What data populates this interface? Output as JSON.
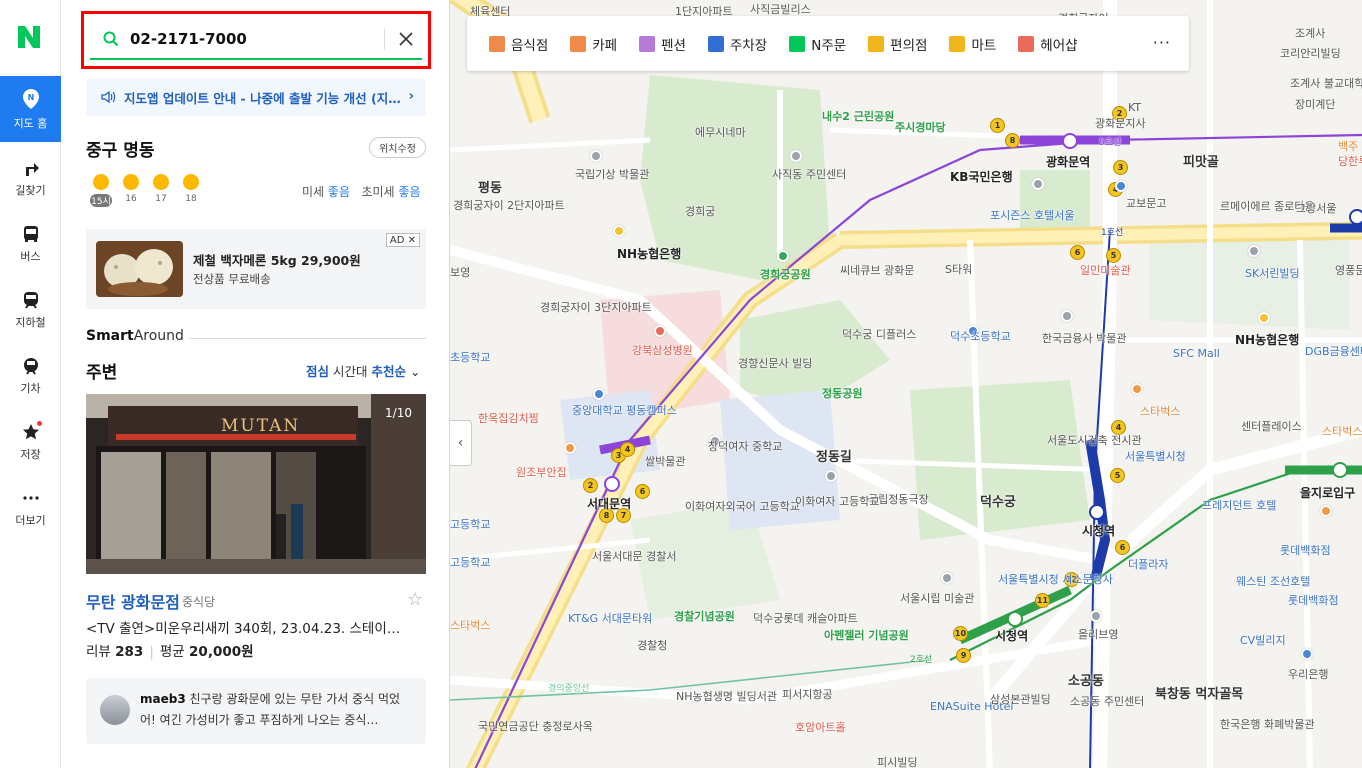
{
  "rail": {
    "logo": "N",
    "items": [
      {
        "label": "지도 홈",
        "icon": "map-pin-icon"
      },
      {
        "label": "길찾기",
        "icon": "directions-icon"
      },
      {
        "label": "버스",
        "icon": "bus-icon"
      },
      {
        "label": "지하철",
        "icon": "subway-icon"
      },
      {
        "label": "기차",
        "icon": "train-icon"
      },
      {
        "label": "저장",
        "icon": "star-icon"
      },
      {
        "label": "더보기",
        "icon": "more-icon"
      }
    ]
  },
  "search": {
    "value": "02-2171-7000"
  },
  "notice": {
    "text": "지도앱 업데이트 안내 - 나중에 출발 기능 개선 (지…"
  },
  "location": {
    "title": "중구 명동",
    "button": "위치수정"
  },
  "weather": {
    "hours": [
      "15시",
      "16",
      "17",
      "18"
    ],
    "dust_label": "미세",
    "dust_value": "좋음",
    "fine_dust_label": "초미세",
    "fine_dust_value": "좋음"
  },
  "ad": {
    "title": "제철 백자메론 5kg 29,900원",
    "subtitle": "전상품 무료배송",
    "tag": "AD"
  },
  "smart_around": {
    "brand_bold": "Smart",
    "brand_rest": "Around"
  },
  "nearby": {
    "title": "주변",
    "opt1": "점심",
    "opt2": "시간대",
    "opt3": "추천순"
  },
  "place": {
    "photo_count": "1/10",
    "sign": "MUTAN",
    "name": "무탄 광화문점",
    "category": "중식당",
    "desc": "<TV 출연>미운우리새끼 340회, 23.04.23. 스테이…",
    "review_label": "리뷰",
    "review_count": "283",
    "price_label": "평균",
    "price": "20,000원",
    "review_user": "maeb3",
    "review_text": "친구랑 광화문에 있는 무탄 가서 중식 먹었어! 여긴 가성비가 좋고 푸짐하게 나오는 중식…"
  },
  "categories": [
    {
      "label": "음식점",
      "color": "#f08a4b"
    },
    {
      "label": "카페",
      "color": "#f08a4b"
    },
    {
      "label": "펜션",
      "color": "#b57bd6"
    },
    {
      "label": "주차장",
      "color": "#2f6fd6"
    },
    {
      "label": "N주문",
      "color": "#03c75a"
    },
    {
      "label": "편의점",
      "color": "#f3b51c"
    },
    {
      "label": "마트",
      "color": "#f3b51c"
    },
    {
      "label": "헤어샵",
      "color": "#e86b5b"
    }
  ],
  "map_labels": {
    "l1": "체육센터",
    "l2": "1단지아파트",
    "l3": "사직금빌리스",
    "l4": "경희궁자이",
    "l5": "조계사",
    "l6": "에무시네마",
    "l7": "내수2 근린공원",
    "l8": "주시경마당",
    "l9": "KT",
    "l10": "광화문지사",
    "l11": "코리안리빌딩",
    "l12": "조계사 불교대학",
    "l13": "장미계단",
    "l14": "국립기상 박물관",
    "l15": "사직동 주민센터",
    "l16": "광화문역",
    "l17": "KB국민은행",
    "l18": "피맛골",
    "l19": "교보문고",
    "l20": "르메이에르 종로타운",
    "l21": "그랑서울",
    "l22": "경희궁자이 2단지아파트",
    "l23": "경희궁",
    "l24": "포시즌스 호텔서울",
    "l25": "NH농협은행",
    "l26": "경희궁공원",
    "l27": "씨네큐브 광화문",
    "l28": "S타워",
    "l29": "일민미술관",
    "l30": "SK서린빌딩",
    "l31": "영풍문고",
    "l32": "경희궁자이 3단지아파트",
    "l33": "덕수궁 디플러스",
    "l34": "덕수초등학교",
    "l35": "한국금융사 박물관",
    "l36": "NH농협은행",
    "l37": "강북삼성병원",
    "l38": "경향신문사 빌딩",
    "l39": "SFC Mall",
    "l40": "DGB금융센터",
    "l41": "정동공원",
    "l42": "중앙대학교 평동캠퍼스",
    "l43": "한옥집김치찜",
    "l44": "스타벅스",
    "l45": "센터플레이스",
    "l46": "창덕여자 중학교",
    "l47": "쌀박물관",
    "l48": "서울도시건축 전시관",
    "l49": "서울특별시청",
    "l50": "정동길",
    "l51": "국립정동극장",
    "l52": "덕수궁",
    "l53": "원조부안집",
    "l54": "서대문역",
    "l55": "이화여자외국어 고등학교",
    "l56": "이화여자 고등학교",
    "l57": "시청역",
    "l58": "프레지던트 호텔",
    "l59": "을지로입구",
    "l60": "서울서대문 경찰서",
    "l61": "더플라자",
    "l62": "롯데백화점",
    "l63": "서울특별시청 서소문청사",
    "l64": "서울시립 미술관",
    "l65": "웨스틴 조선호텔",
    "l66": "KT&G 서대문타워",
    "l67": "경찰기념공원",
    "l68": "덕수궁롯데 캐슬아파트",
    "l69": "아펜젤러 기념공원",
    "l70": "을리브영",
    "l71": "시청역",
    "l72": "경찰청",
    "l73": "CV빌리지",
    "l74": "우리은행",
    "l75": "NH농협생명 빌딩서관",
    "l76": "피서지항공",
    "l77": "ENASuite Hotel",
    "l78": "삼성본관빌딩",
    "l79": "소공동 주민센터",
    "l80": "북창동 먹자골목",
    "l81": "국민연금공단 충정로사옥",
    "l82": "호암아트홀",
    "l83": "한국은행 화폐박물관",
    "l84": "스타벅스",
    "l85": "소공동",
    "l86": "초등학교",
    "l87": "고등학교",
    "l88": "스타벅스",
    "l89": "고등학교",
    "l90": "5호선",
    "l91": "1호선",
    "l92": "2호선",
    "l93": "경의중앙선",
    "l94": "보영",
    "l95": "평동",
    "l96": "피시빌딩",
    "l97": "당한루",
    "l98": "백주",
    "l99": "2단지아파트",
    "l100": "고등학교",
    "l101": "스타벅스",
    "l102": "롯데백화점",
    "l103": "1-1",
    "l104": "2"
  }
}
